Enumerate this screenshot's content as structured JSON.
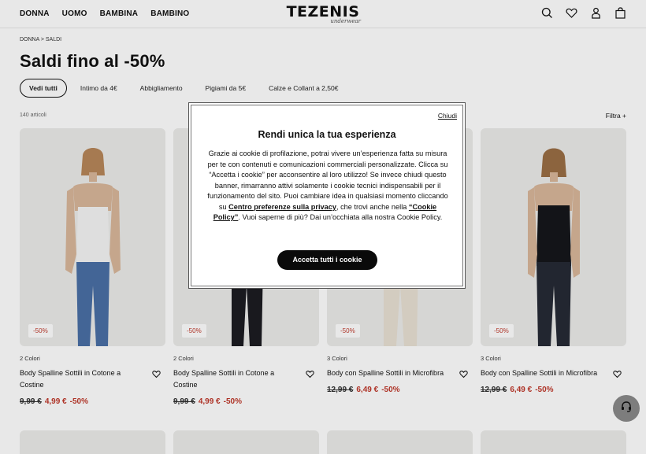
{
  "header": {
    "nav": [
      "DONNA",
      "UOMO",
      "BAMBINA",
      "BAMBINO"
    ],
    "logo": "TEZENIS",
    "logo_sub": "underwear",
    "icons": [
      "search-icon",
      "heart-icon",
      "user-icon",
      "bag-icon"
    ]
  },
  "breadcrumb": "DONNA > SALDI",
  "page_title": "Saldi fino al -50%",
  "chips": [
    "Vedi tutti",
    "Intimo da 4€",
    "Abbigliamento",
    "Pigiami da 5€",
    "Calze e Collant a 2,50€"
  ],
  "count": "140 articoli",
  "filter_label": "Filtra +",
  "products": [
    {
      "badge": "-50%",
      "colors": "2 Colori",
      "name": "Body Spalline Sottili in Cotone a Costine",
      "old_price": "9,99 €",
      "new_price": "4,99 €",
      "discount": "-50%"
    },
    {
      "badge": "-50%",
      "colors": "2 Colori",
      "name": "Body Spalline Sottili in Cotone a Costine",
      "old_price": "9,99 €",
      "new_price": "4,99 €",
      "discount": "-50%"
    },
    {
      "badge": "-50%",
      "colors": "3 Colori",
      "name": "Body con Spalline Sottili in Microfibra",
      "old_price": "12,99 €",
      "new_price": "6,49 €",
      "discount": "-50%"
    },
    {
      "badge": "-50%",
      "colors": "3 Colori",
      "name": "Body con Spalline Sottili in Microfibra",
      "old_price": "12,99 €",
      "new_price": "6,49 €",
      "discount": "-50%"
    }
  ],
  "modal": {
    "close_label": "Chiudi",
    "title": "Rendi unica la tua esperienza",
    "body_1": "Grazie ai cookie di profilazione, potrai vivere un’esperienza fatta su misura per te con contenuti e comunicazioni commerciali personalizzate. Clicca su “Accetta i cookie” per acconsentire al loro utilizzo! Se invece chiudi questo banner, rimarranno attivi solamente i cookie tecnici indispensabili per il funzionamento del sito. Puoi cambiare idea in qualsiasi momento cliccando su ",
    "link_1": "Centro preferenze sulla privacy",
    "body_2": ", che trovi anche nella ",
    "link_2": "“Cookie Policy”",
    "body_3": ". Vuoi saperne di più? Dai un’occhiata alla nostra Cookie Policy.",
    "accept_label": "Accetta tutti i cookie"
  },
  "colors": {
    "sale_red": "#c0392b",
    "button_black": "#0a0a0a"
  }
}
